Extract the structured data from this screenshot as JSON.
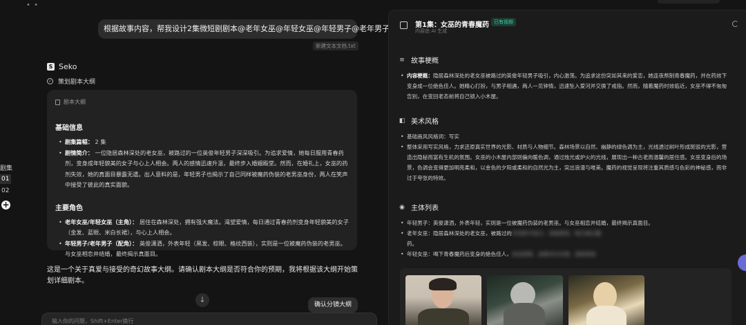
{
  "episodes": {
    "label": "剧集",
    "items": [
      "01",
      "02"
    ],
    "active": "01"
  },
  "chat": {
    "top_dots": "• •",
    "user_message": "根据故事内容，帮我设计2集微短剧剧本@老年女巫@年轻女巫@年轻男子@老年男子",
    "attachment": "新建文本文档.txt",
    "agent_name": "Seko",
    "step_label": "策划剧本大纲",
    "card": {
      "header": "剧本大纲",
      "basic_title": "基础信息",
      "basic_items": [
        {
          "key": "剧集篇幅：",
          "text": " 2 集"
        },
        {
          "key": "剧情简介：",
          "text": " 一位隐居森林深处的老女巫，被路过的一位英俊年轻男子深深吸引。为追求爱情，她每日服用青春药剂，变身成年轻貌美的女子与心上人相会。两人的感情迅速升温，最终步入婚姻殿堂。然而，在婚礼上，女巫的药剂失效，她的真面目暴露无遗。出人意料的是，年轻男子也揭示了自己同样被魔药伪装的老男巫身份，两人在笑声中接受了彼此的真实面貌。"
        }
      ],
      "roles_title": "主要角色",
      "role_items": [
        {
          "key": "老年女巫/年轻女巫（主角）：",
          "text": " 居住在森林深处，拥有强大魔法。渴望爱情，每日通过青春药剂变身年轻貌美的女子（金发、蓝眼、米白长裙），与心上人相会。"
        },
        {
          "key": "年轻男子/老年男子（配角）：",
          "text": " 英俊潇洒，外表年轻（黑发、棕眼、格纹西装），实则是一位被魔药伪装的老男巫。与女巫相恋并结婚，最终揭示真面目。"
        }
      ]
    },
    "closing_text": "这是一个关于真爱与接受的奇幻故事大纲。请确认剧本大纲是否符合你的预期，我将根据该大纲开始策划详细剧本。",
    "confirm_label": "确认分镜大纲",
    "scroll_icon": "↓",
    "input_placeholder": "输入你的问题，Shift+Enter换行"
  },
  "panel": {
    "title": "第1集：女巫的青春魔药",
    "badge": "已有视频",
    "subtitle": "内容由 AI 生成",
    "summary_title": "故事梗概",
    "summary_items": [
      {
        "key": "内容梗概：",
        "text": "隐居森林深处的老女巫被路过的英俊年轻男子吸引，内心激荡。为追求这份突如其来的爱恋，她连夜熬制青春魔药，并在药效下变身成一位绝色佳人。她精心打扮，与男子相遇，两人一见钟情，迅速坠入爱河并交换了戒指。然而，随着魔药时效临近，女巫不得不匆匆告别，在变回老态前将自己锁入小木屋。"
      }
    ],
    "art_title": "美术风格",
    "art_items": [
      {
        "key": "",
        "text": "基础画风风格词：写实"
      },
      {
        "key": "",
        "text": "整体采用写实风格，力求还原真实世界的光影、材质与人物细节。森林场景以自然、幽静的绿色调为主，光线透过树叶形成斑驳的光影，营造出隐秘而富有生机的氛围。女巫的小木屋内部则偏向暖色调，通过烛光或炉火的光线，展现出一种古老而温馨的居住感。女巫变身后的场景，色调会变得更加明亮柔和，以金色的夕阳或柔和的自然光为主，突出浪漫与唯美。魔药的视觉呈现将注重其质感与色彩的神秘感，而非过于夸张的特效。"
      }
    ],
    "cast_title": "主体列表",
    "cast_items": [
      {
        "text": "年轻男子：英俊潇洒，外表年轻，实则是一位被魔药伪装的老男巫。与女巫相恋并结婚，最终揭示真面目。",
        "blur": ""
      },
      {
        "text": "老年女巫：隐居森林深处的老女巫，被路过的",
        "blur": "年轻男子吸引，渴望爱情，每日通过魔"
      },
      {
        "text": "年轻女巫：喝下青春魔药后变身的绝色佳人，",
        "blur": "金发蓝眼，身着米白长裙，温柔美丽"
      }
    ],
    "cast_extra": "药。",
    "icons": {
      "summary": "list-icon",
      "art": "palette-icon",
      "cast": "user-icon",
      "header": "script-icon",
      "refresh": "refresh-icon"
    }
  }
}
